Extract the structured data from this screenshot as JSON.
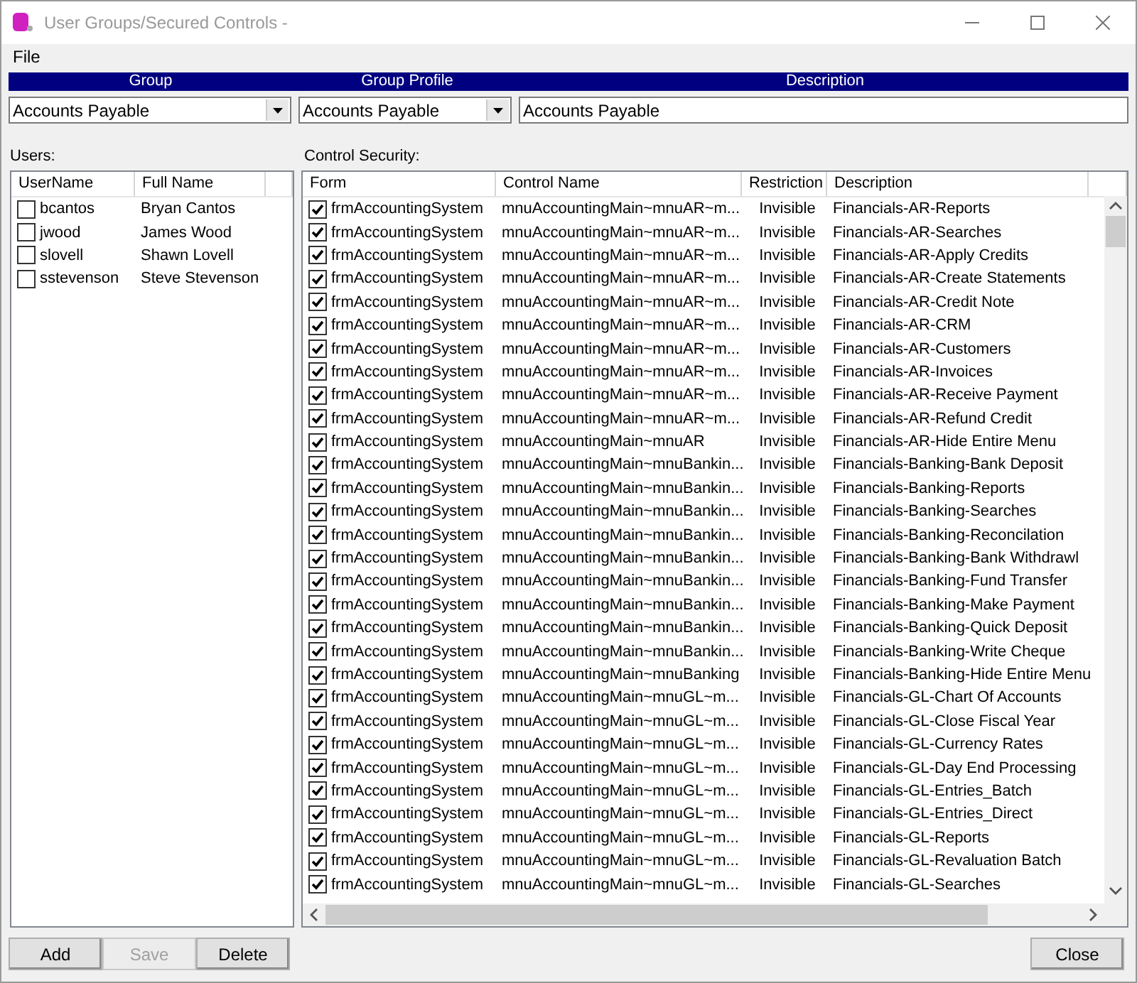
{
  "window": {
    "title": "User Groups/Secured Controls -"
  },
  "menu": [
    "File"
  ],
  "header": {
    "columns": [
      "Group",
      "Group Profile",
      "Description"
    ]
  },
  "group": {
    "value": "Accounts Payable"
  },
  "group_profile": {
    "value": "Accounts Payable"
  },
  "description": {
    "value": "Accounts Payable"
  },
  "users": {
    "label": "Users:",
    "columns": [
      "UserName",
      "Full Name"
    ],
    "rows": [
      {
        "username": "bcantos",
        "full_name": "Bryan Cantos",
        "checked": false
      },
      {
        "username": "jwood",
        "full_name": "James Wood",
        "checked": false
      },
      {
        "username": "slovell",
        "full_name": "Shawn Lovell",
        "checked": false
      },
      {
        "username": "sstevenson",
        "full_name": "Steve Stevenson",
        "checked": false
      }
    ]
  },
  "control_security": {
    "label": "Control Security:",
    "columns": [
      "Form",
      "Control Name",
      "Restriction",
      "Description"
    ],
    "rows": [
      {
        "form": "frmAccountingSystem",
        "control": "mnuAccountingMain~mnuAR~m...",
        "restriction": "Invisible",
        "description": "Financials-AR-Reports",
        "checked": true
      },
      {
        "form": "frmAccountingSystem",
        "control": "mnuAccountingMain~mnuAR~m...",
        "restriction": "Invisible",
        "description": "Financials-AR-Searches",
        "checked": true
      },
      {
        "form": "frmAccountingSystem",
        "control": "mnuAccountingMain~mnuAR~m...",
        "restriction": "Invisible",
        "description": "Financials-AR-Apply Credits",
        "checked": true
      },
      {
        "form": "frmAccountingSystem",
        "control": "mnuAccountingMain~mnuAR~m...",
        "restriction": "Invisible",
        "description": "Financials-AR-Create Statements",
        "checked": true
      },
      {
        "form": "frmAccountingSystem",
        "control": "mnuAccountingMain~mnuAR~m...",
        "restriction": "Invisible",
        "description": "Financials-AR-Credit Note",
        "checked": true
      },
      {
        "form": "frmAccountingSystem",
        "control": "mnuAccountingMain~mnuAR~m...",
        "restriction": "Invisible",
        "description": "Financials-AR-CRM",
        "checked": true
      },
      {
        "form": "frmAccountingSystem",
        "control": "mnuAccountingMain~mnuAR~m...",
        "restriction": "Invisible",
        "description": "Financials-AR-Customers",
        "checked": true
      },
      {
        "form": "frmAccountingSystem",
        "control": "mnuAccountingMain~mnuAR~m...",
        "restriction": "Invisible",
        "description": "Financials-AR-Invoices",
        "checked": true
      },
      {
        "form": "frmAccountingSystem",
        "control": "mnuAccountingMain~mnuAR~m...",
        "restriction": "Invisible",
        "description": "Financials-AR-Receive Payment",
        "checked": true
      },
      {
        "form": "frmAccountingSystem",
        "control": "mnuAccountingMain~mnuAR~m...",
        "restriction": "Invisible",
        "description": "Financials-AR-Refund Credit",
        "checked": true
      },
      {
        "form": "frmAccountingSystem",
        "control": "mnuAccountingMain~mnuAR",
        "restriction": "Invisible",
        "description": "Financials-AR-Hide Entire Menu",
        "checked": true
      },
      {
        "form": "frmAccountingSystem",
        "control": "mnuAccountingMain~mnuBankin...",
        "restriction": "Invisible",
        "description": "Financials-Banking-Bank Deposit",
        "checked": true
      },
      {
        "form": "frmAccountingSystem",
        "control": "mnuAccountingMain~mnuBankin...",
        "restriction": "Invisible",
        "description": "Financials-Banking-Reports",
        "checked": true
      },
      {
        "form": "frmAccountingSystem",
        "control": "mnuAccountingMain~mnuBankin...",
        "restriction": "Invisible",
        "description": "Financials-Banking-Searches",
        "checked": true
      },
      {
        "form": "frmAccountingSystem",
        "control": "mnuAccountingMain~mnuBankin...",
        "restriction": "Invisible",
        "description": "Financials-Banking-Reconcilation",
        "checked": true
      },
      {
        "form": "frmAccountingSystem",
        "control": "mnuAccountingMain~mnuBankin...",
        "restriction": "Invisible",
        "description": "Financials-Banking-Bank Withdrawl",
        "checked": true
      },
      {
        "form": "frmAccountingSystem",
        "control": "mnuAccountingMain~mnuBankin...",
        "restriction": "Invisible",
        "description": "Financials-Banking-Fund Transfer",
        "checked": true
      },
      {
        "form": "frmAccountingSystem",
        "control": "mnuAccountingMain~mnuBankin...",
        "restriction": "Invisible",
        "description": "Financials-Banking-Make Payment",
        "checked": true
      },
      {
        "form": "frmAccountingSystem",
        "control": "mnuAccountingMain~mnuBankin...",
        "restriction": "Invisible",
        "description": "Financials-Banking-Quick Deposit",
        "checked": true
      },
      {
        "form": "frmAccountingSystem",
        "control": "mnuAccountingMain~mnuBankin...",
        "restriction": "Invisible",
        "description": "Financials-Banking-Write Cheque",
        "checked": true
      },
      {
        "form": "frmAccountingSystem",
        "control": "mnuAccountingMain~mnuBanking",
        "restriction": "Invisible",
        "description": "Financials-Banking-Hide Entire Menu",
        "checked": true
      },
      {
        "form": "frmAccountingSystem",
        "control": "mnuAccountingMain~mnuGL~m...",
        "restriction": "Invisible",
        "description": "Financials-GL-Chart Of Accounts",
        "checked": true
      },
      {
        "form": "frmAccountingSystem",
        "control": "mnuAccountingMain~mnuGL~m...",
        "restriction": "Invisible",
        "description": "Financials-GL-Close Fiscal Year",
        "checked": true
      },
      {
        "form": "frmAccountingSystem",
        "control": "mnuAccountingMain~mnuGL~m...",
        "restriction": "Invisible",
        "description": "Financials-GL-Currency Rates",
        "checked": true
      },
      {
        "form": "frmAccountingSystem",
        "control": "mnuAccountingMain~mnuGL~m...",
        "restriction": "Invisible",
        "description": "Financials-GL-Day End Processing",
        "checked": true
      },
      {
        "form": "frmAccountingSystem",
        "control": "mnuAccountingMain~mnuGL~m...",
        "restriction": "Invisible",
        "description": "Financials-GL-Entries_Batch",
        "checked": true
      },
      {
        "form": "frmAccountingSystem",
        "control": "mnuAccountingMain~mnuGL~m...",
        "restriction": "Invisible",
        "description": "Financials-GL-Entries_Direct",
        "checked": true
      },
      {
        "form": "frmAccountingSystem",
        "control": "mnuAccountingMain~mnuGL~m...",
        "restriction": "Invisible",
        "description": "Financials-GL-Reports",
        "checked": true
      },
      {
        "form": "frmAccountingSystem",
        "control": "mnuAccountingMain~mnuGL~m...",
        "restriction": "Invisible",
        "description": "Financials-GL-Revaluation Batch",
        "checked": true
      },
      {
        "form": "frmAccountingSystem",
        "control": "mnuAccountingMain~mnuGL~m...",
        "restriction": "Invisible",
        "description": "Financials-GL-Searches",
        "checked": true
      }
    ]
  },
  "buttons": [
    {
      "label": "Add",
      "disabled": false
    },
    {
      "label": "Save",
      "disabled": true
    },
    {
      "label": "Delete",
      "disabled": false
    },
    {
      "label": "Close",
      "disabled": false
    }
  ]
}
